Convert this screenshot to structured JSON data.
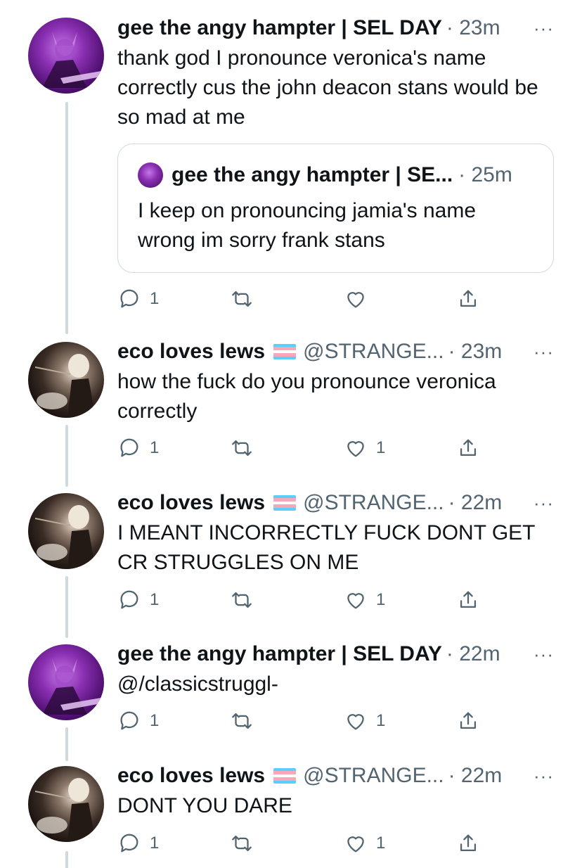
{
  "tweets": [
    {
      "name": "gee the angy hampter | SEL DAY",
      "handle": "",
      "time": "· 23m",
      "text": "thank god I pronounce veronica's name correctly cus the john deacon stans would be so mad at me",
      "quote": {
        "name": "gee the angy hampter | SE...",
        "time": "· 25m",
        "text": "I keep on pronouncing jamia's name wrong im sorry frank stans"
      },
      "reply_count": "1",
      "retweet_count": "",
      "like_count": ""
    },
    {
      "name": "eco loves lews",
      "handle": "@STRANGE...",
      "time": "· 23m",
      "text": "how the fuck do you pronounce veronica correctly",
      "reply_count": "1",
      "retweet_count": "",
      "like_count": "1"
    },
    {
      "name": "eco loves lews",
      "handle": "@STRANGE...",
      "time": "· 22m",
      "text": "I MEANT INCORRECTLY FUCK DONT GET CR STRUGGLES ON ME",
      "reply_count": "1",
      "retweet_count": "",
      "like_count": "1"
    },
    {
      "name": "gee the angy hampter | SEL DAY",
      "handle": "",
      "time": "· 22m",
      "text": "@/classicstruggl-",
      "reply_count": "1",
      "retweet_count": "",
      "like_count": "1"
    },
    {
      "name": "eco loves lews",
      "handle": "@STRANGE...",
      "time": "· 22m",
      "text": "DONT YOU DARE",
      "reply_count": "1",
      "retweet_count": "",
      "like_count": "1"
    }
  ],
  "icons": {
    "reply": "reply-icon",
    "retweet": "retweet-icon",
    "like": "heart-icon",
    "share": "share-icon",
    "more": "more-icon",
    "flag": "trans-flag-icon"
  },
  "more_glyph": "···",
  "colors": {
    "text": "#0f1419",
    "secondary": "#536471",
    "thread_line": "#cfd9de",
    "border": "#cfd9de",
    "flag_blue": "#5bcefa",
    "flag_pink": "#f5a9b8",
    "flag_white": "#ffffff"
  }
}
